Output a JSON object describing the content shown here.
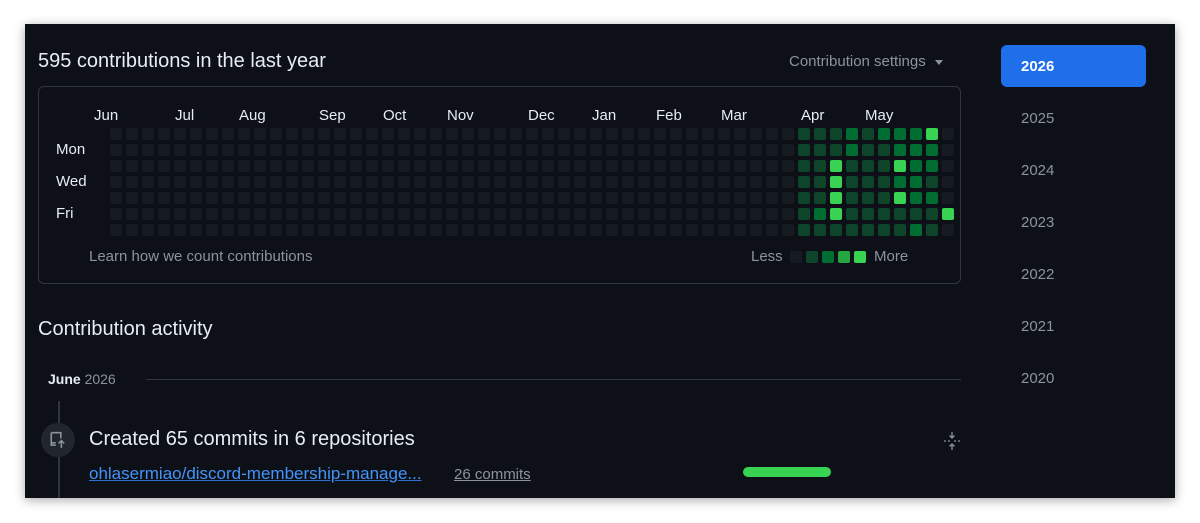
{
  "colors": {
    "level0": "#161b22",
    "level1": "#0e4429",
    "level2": "#006d32",
    "level3": "#26a641",
    "level4": "#39d353",
    "accent": "#1f6feb",
    "progress": "#39d353"
  },
  "summary": {
    "title": "595 contributions in the last year"
  },
  "settings": {
    "label": "Contribution settings",
    "icon": "caret-down-icon"
  },
  "graph": {
    "months": [
      "Jun",
      "Jul",
      "Aug",
      "Sep",
      "Oct",
      "Nov",
      "Dec",
      "Jan",
      "Feb",
      "Mar",
      "Apr",
      "May"
    ],
    "day_labels": [
      "Mon",
      "Wed",
      "Fri"
    ],
    "week_count": 53,
    "active_weeks": [
      [
        1,
        1,
        1,
        1,
        1,
        1,
        1
      ],
      [
        1,
        1,
        1,
        1,
        1,
        2,
        1
      ],
      [
        1,
        1,
        4,
        4,
        4,
        4,
        1
      ],
      [
        2,
        2,
        1,
        1,
        1,
        1,
        1
      ],
      [
        1,
        1,
        1,
        1,
        1,
        1,
        1
      ],
      [
        2,
        1,
        1,
        1,
        1,
        1,
        1
      ],
      [
        2,
        2,
        4,
        2,
        4,
        1,
        1
      ],
      [
        2,
        2,
        2,
        2,
        2,
        1,
        2
      ],
      [
        4,
        2,
        2,
        1,
        2,
        1,
        1
      ],
      [
        0,
        0,
        0,
        0,
        0,
        4,
        0
      ]
    ],
    "learn_link": "Learn how we count contributions",
    "legend_less": "Less",
    "legend_more": "More",
    "legend_levels": [
      0,
      1,
      2,
      3,
      4
    ]
  },
  "activity": {
    "title": "Contribution activity",
    "month": "June",
    "year": "2026",
    "event": {
      "icon": "repo-push-icon",
      "title": "Created 65 commits in 6 repositories",
      "collapse_icon": "collapse-icon",
      "repos": [
        {
          "name": "ohlasermiao/discord-membership-manage...",
          "commits": "26 commits",
          "share": 0.4
        }
      ]
    }
  },
  "years": [
    {
      "label": "2026",
      "active": true
    },
    {
      "label": "2025",
      "active": false
    },
    {
      "label": "2024",
      "active": false
    },
    {
      "label": "2023",
      "active": false
    },
    {
      "label": "2022",
      "active": false
    },
    {
      "label": "2021",
      "active": false
    },
    {
      "label": "2020",
      "active": false
    }
  ]
}
